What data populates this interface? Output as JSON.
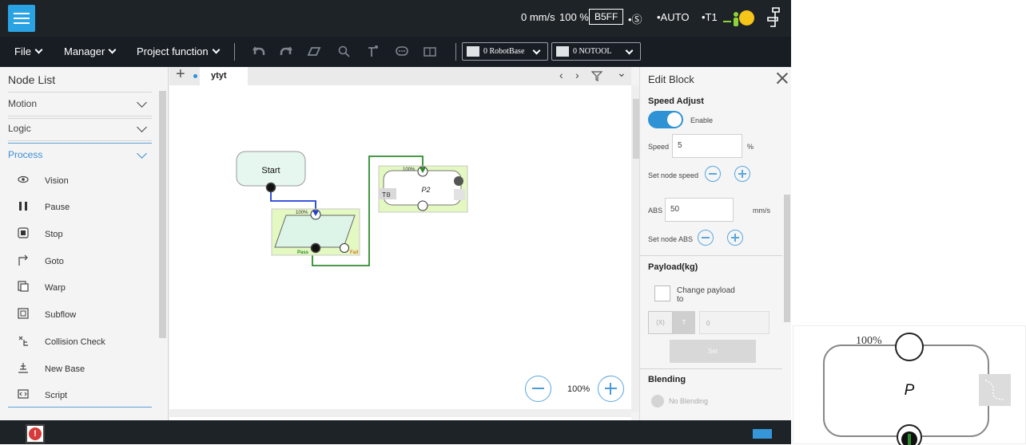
{
  "status": {
    "speed": "0 mm/s",
    "percent": "100 %",
    "code": "B5FF",
    "s_indicator": "•Ⓢ",
    "mode": "•AUTO",
    "t1": "•T1"
  },
  "menubar": {
    "file": "File",
    "manager": "Manager",
    "project_function": "Project function",
    "robot_base": "0 RobotBase",
    "tool": "0 NOTOOL"
  },
  "nodelist": {
    "title": "Node List",
    "sections": {
      "motion": "Motion",
      "logic": "Logic",
      "process": "Process"
    },
    "items": [
      {
        "label": "Vision",
        "icon": "eye-icon"
      },
      {
        "label": "Pause",
        "icon": "pause-icon"
      },
      {
        "label": "Stop",
        "icon": "stop-icon"
      },
      {
        "label": "Goto",
        "icon": "goto-arrow-icon"
      },
      {
        "label": "Warp",
        "icon": "warp-icon"
      },
      {
        "label": "Subflow",
        "icon": "subflow-icon"
      },
      {
        "label": "Collision Check",
        "icon": "collision-check-icon"
      },
      {
        "label": "New Base",
        "icon": "new-base-icon"
      },
      {
        "label": "Script",
        "icon": "script-icon"
      }
    ]
  },
  "canvas": {
    "tab": "ytyt",
    "zoom": "100%",
    "nodes": {
      "start": {
        "label": "Start"
      },
      "decision": {
        "percent": "100%",
        "pass": "Pass",
        "fail": "Fail"
      },
      "point": {
        "percent": "100%",
        "name": "P2",
        "tool": "T0"
      }
    }
  },
  "editblock": {
    "title": "Edit Block",
    "speed_adjust": "Speed Adjust",
    "enable": "Enable",
    "speed_label": "Speed",
    "speed_value": "5",
    "speed_unit": "%",
    "set_node_speed": "Set node speed",
    "abs_label": "ABS",
    "abs_value": "50",
    "abs_unit": "mm/s",
    "set_node_abs": "Set node ABS",
    "payload": "Payload(kg)",
    "change_payload": "Change payload",
    "change_payload_to": "to",
    "payload_x": "(X)",
    "payload_t": "T",
    "payload_value": "0",
    "set_button": "Set",
    "blending": "Blending",
    "no_blending": "No Blending"
  },
  "preview": {
    "percent": "100%",
    "name": "P"
  },
  "colors": {
    "accent": "#2f92d5",
    "topbar": "#1e2327",
    "node_fill": "#e4f8c2",
    "start_fill": "#e6f7ef",
    "flow_blue": "#1f3fd6",
    "flow_green": "#2e8b2e",
    "status_yellow": "#f6c51a"
  }
}
